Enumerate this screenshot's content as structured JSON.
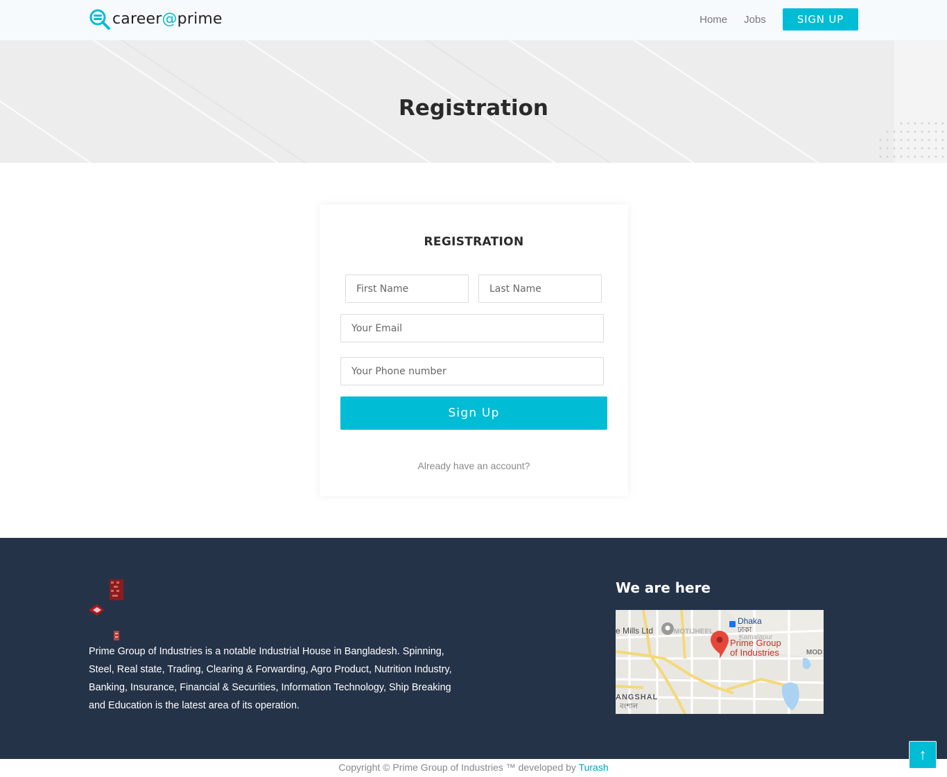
{
  "header": {
    "logo_text_pre": "career",
    "logo_text_at": "@",
    "logo_text_post": "prime",
    "nav": {
      "home": "Home",
      "jobs": "Jobs",
      "signup": "SIGN UP"
    }
  },
  "hero": {
    "title": "Registration"
  },
  "form": {
    "title": "REGISTRATION",
    "first_name_placeholder": "First Name",
    "last_name_placeholder": "Last Name",
    "email_placeholder": "Your Email",
    "phone_placeholder": "Your Phone number",
    "submit_label": "Sign Up",
    "login_link": "Already have an account?"
  },
  "footer": {
    "description": "Prime Group of Industries is a notable Industrial House in Bangladesh. Spinning, Steel, Real state, Trading, Clearing & Forwarding, Agro Product, Nutrition Industry, Banking, Insurance, Financial & Securities, Information Technology, Ship Breaking and Education is the latest area of its operation.",
    "map_title": "We are here",
    "map": {
      "pin_label_1": "Prime Group",
      "pin_label_2": "of Industries",
      "label_mills": "e Mills Ltd",
      "label_motijheel": "MOTIJHEEL",
      "label_dhaka": "Dhaka",
      "label_dhaka_bn": "ঢাকা",
      "label_kamalapur": "Kamalapur",
      "label_bangshal": "ANGSHAL",
      "label_bangshal_bn": "বংশাল",
      "label_mod": "MOD"
    }
  },
  "copyright": {
    "text": "Copyright © Prime Group of Industries ™ developed by",
    "link": "Turash"
  },
  "to_top": "↑",
  "colors": {
    "accent": "#00bcd4",
    "footer_bg": "#253349",
    "header_bg": "#f7fafd"
  }
}
